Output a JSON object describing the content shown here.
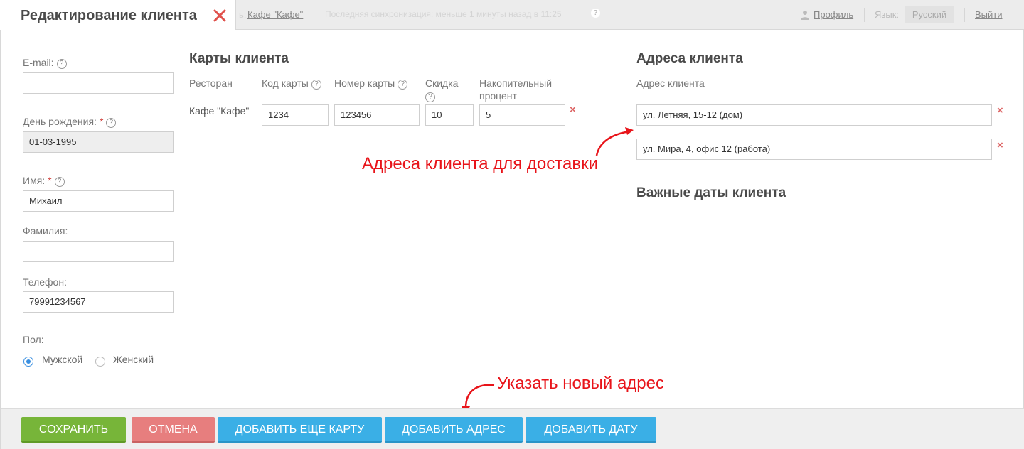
{
  "tab": {
    "title": "Редактирование клиента"
  },
  "topbar": {
    "prefix": "ь:",
    "restaurant_link": "Кафе \"Кафе\"",
    "sync_text": "Последняя синхронизация: меньше 1 минуты назад в 11:25",
    "sync_help": "?",
    "profile_label": "Профиль",
    "lang_label": "Язык:",
    "lang_value": "Русский",
    "logout_label": "Выйти"
  },
  "form": {
    "email": {
      "label": "E-mail:",
      "help": "?",
      "value": ""
    },
    "birthday": {
      "label": "День рождения:",
      "required": "*",
      "help": "?",
      "value": "01-03-1995"
    },
    "first_name": {
      "label": "Имя:",
      "required": "*",
      "help": "?",
      "value": "Михаил"
    },
    "last_name": {
      "label": "Фамилия:",
      "value": ""
    },
    "phone": {
      "label": "Телефон:",
      "value": "79991234567"
    },
    "gender": {
      "label": "Пол:",
      "options": [
        {
          "label": "Мужской",
          "checked": true
        },
        {
          "label": "Женский",
          "checked": false
        }
      ]
    }
  },
  "cards": {
    "title": "Карты клиента",
    "columns": {
      "restaurant": "Ресторан",
      "card_code": "Код карты",
      "card_number": "Номер карты",
      "discount": "Скидка",
      "accum_line1": "Накопительный",
      "accum_line2": "процент",
      "help": "?"
    },
    "rows": [
      {
        "restaurant": "Кафе \"Кафе\"",
        "card_code": "1234",
        "card_number": "123456",
        "discount": "10",
        "accum": "5",
        "delete": "×"
      }
    ]
  },
  "addresses": {
    "title": "Адреса клиента",
    "column": "Адрес клиента",
    "items": [
      {
        "value": "ул. Летняя, 15-12 (дом)",
        "delete": "×"
      },
      {
        "value": "ул. Мира, 4, офис 12 (работа)",
        "delete": "×"
      }
    ]
  },
  "dates": {
    "title": "Важные даты клиента"
  },
  "annotations": {
    "addresses": "Адреса клиента для доставки",
    "new_address": "Указать новый адрес",
    "color": "#e8141a"
  },
  "footer": {
    "save": "Сохранить",
    "cancel": "Отмена",
    "add_card": "Добавить еще карту",
    "add_address": "Добавить адрес",
    "add_date": "Добавить дату"
  },
  "colors": {
    "save": "#77b539",
    "cancel": "#e77e7e",
    "blue": "#3aafe6",
    "radio_checked": "#3a8fe0"
  }
}
